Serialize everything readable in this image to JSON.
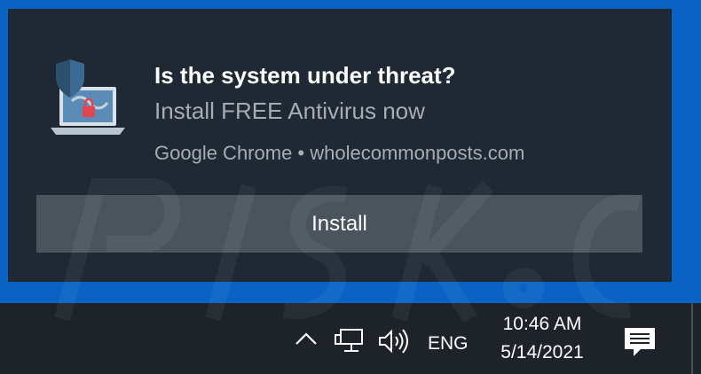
{
  "notification": {
    "title": "Is the system under threat?",
    "body": "Install FREE Antivirus now",
    "attribution": "Google Chrome • wholecommonposts.com",
    "icon": "antivirus-laptop-shield-icon",
    "action_label": "Install"
  },
  "taskbar": {
    "language": "ENG",
    "time": "10:46 AM",
    "date": "5/14/2021",
    "icons": [
      "chevron-up-icon",
      "network-icon",
      "volume-icon",
      "action-center-icon"
    ]
  },
  "watermark": {
    "text": "risk.com"
  },
  "colors": {
    "desktop": "#0a63c4",
    "toast_background": "#1f2833",
    "button_background": "#4b545c",
    "taskbar": "#1e2329"
  }
}
